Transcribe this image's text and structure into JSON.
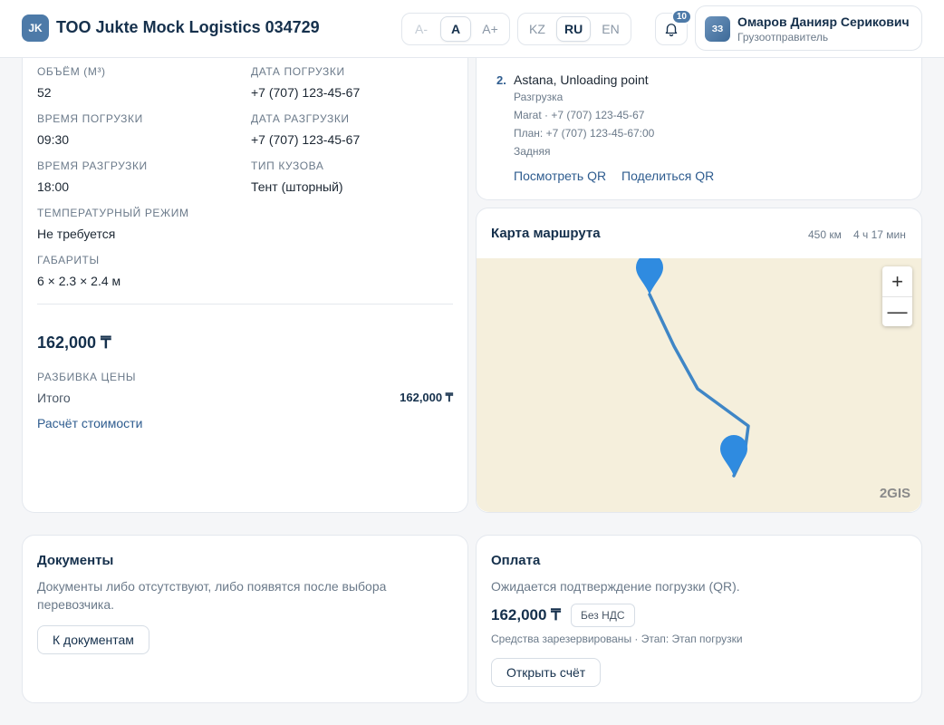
{
  "header": {
    "logo_text": "JK",
    "company": "ТОО Jukte Mock Logistics 034729",
    "font_sizes": [
      "A-",
      "A",
      "A+"
    ],
    "font_active": "A",
    "languages": [
      "KZ",
      "RU",
      "EN"
    ],
    "language_active": "RU",
    "notifications_count": "10",
    "user": {
      "initials": "ЗЗ",
      "name": "Омаров Данияр Серикович",
      "role": "Грузоотправитель"
    }
  },
  "cargo": {
    "fields": [
      {
        "label": "Объём (м³)",
        "value": "52"
      },
      {
        "label": "Дата погрузки",
        "value": "+7 (707) 123-45-67"
      },
      {
        "label": "Время погрузки",
        "value": "09:30"
      },
      {
        "label": "Дата разгрузки",
        "value": "+7 (707) 123-45-67"
      },
      {
        "label": "Время разгрузки",
        "value": "18:00"
      },
      {
        "label": "Тип кузова",
        "value": "Тент (шторный)"
      },
      {
        "label": "Температурный режим",
        "value": "Не требуется"
      },
      {
        "label": "Габариты",
        "value": "6 × 2.3 × 2.4 м"
      }
    ],
    "price": "162,000 ₸",
    "breakdown_label": "Разбивка цены",
    "total_label": "Итого",
    "total_value": "162,000 ₸",
    "calc_link": "Расчёт стоимости"
  },
  "route_point": {
    "number": "2.",
    "title": "Astana, Unloading point",
    "type": "Разгрузка",
    "contact": "Marat · +7 (707) 123-45-67",
    "plan": "План: +7 (707) 123-45-67:00",
    "loading_side": "Задняя",
    "view_qr": "Посмотреть QR",
    "share_qr": "Поделиться QR"
  },
  "map": {
    "title": "Карта маршрута",
    "distance": "450 км",
    "duration": "4 ч 17 мин",
    "zoom_in": "+",
    "zoom_out": "—",
    "brand": "2GIS",
    "route_color": "#3f86c6",
    "marker_color": "#2f8be0",
    "background_color": "#f5efdc"
  },
  "documents": {
    "title": "Документы",
    "text": "Документы либо отсутствуют, либо появятся после выбора перевозчика.",
    "button": "К документам"
  },
  "payment": {
    "title": "Оплата",
    "status": "Ожидается подтверждение погрузки (QR).",
    "amount": "162,000 ₸",
    "vat": "Без НДС",
    "note": "Средства зарезервированы · Этап: Этап погрузки",
    "button": "Открыть счёт"
  }
}
